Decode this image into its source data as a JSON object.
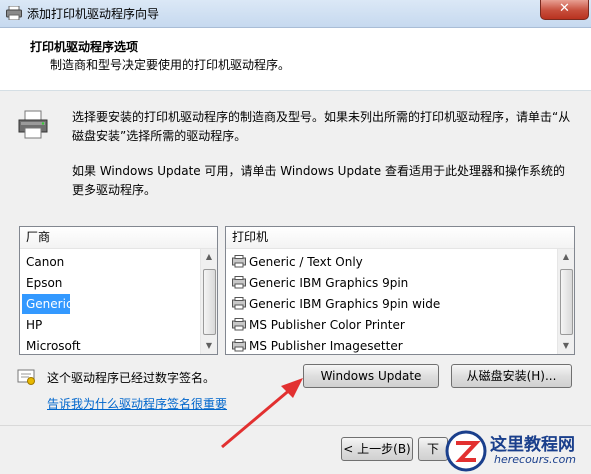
{
  "window": {
    "title": "添加打印机驱动程序向导",
    "close_label": "✕"
  },
  "header": {
    "title": "打印机驱动程序选项",
    "subtitle": "制造商和型号决定要使用的打印机驱动程序。"
  },
  "description": {
    "line1": "选择要安装的打印机驱动程序的制造商及型号。如果未列出所需的打印机驱动程序，请单击“从磁盘安装”选择所需的驱动程序。",
    "line2": "如果 Windows Update 可用，请单击 Windows Update 查看适用于此处理器和操作系统的更多驱动程序。"
  },
  "manufacturers": {
    "header": "厂商",
    "items": [
      "Canon",
      "Epson",
      "Generic",
      "HP",
      "Microsoft"
    ],
    "selected": "Generic"
  },
  "printers": {
    "header": "打印机",
    "items": [
      "Generic / Text Only",
      "Generic IBM Graphics 9pin",
      "Generic IBM Graphics 9pin wide",
      "MS Publisher Color Printer",
      "MS Publisher Imagesetter"
    ]
  },
  "signed": {
    "text": "这个驱动程序已经过数字签名。",
    "link": "告诉我为什么驱动程序签名很重要"
  },
  "buttons": {
    "windows_update": "Windows Update",
    "have_disk": "从磁盘安装(H)...",
    "back": "< 上一步(B)",
    "next": "下"
  },
  "watermark": {
    "title": "这里教程网",
    "url": "herecours.com"
  },
  "colors": {
    "selection": "#3399ff",
    "link": "#0066cc",
    "arrow": "#e23030"
  }
}
